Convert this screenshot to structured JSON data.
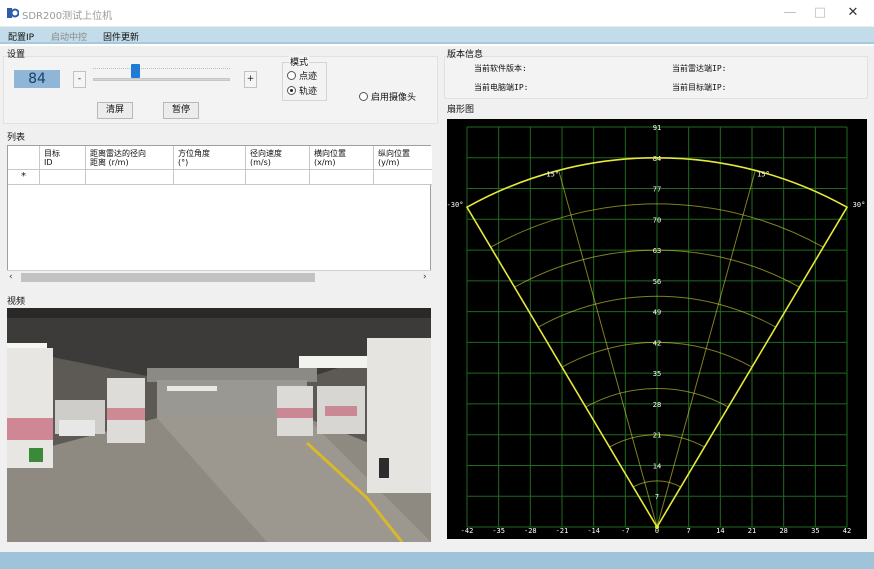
{
  "window": {
    "title": "SDR200测试上位机",
    "minimize": "—",
    "maximize": "□",
    "close": "✕"
  },
  "menu": {
    "items": [
      {
        "label": "配置IP",
        "enabled": true
      },
      {
        "label": "启动中控",
        "enabled": false
      },
      {
        "label": "固件更新",
        "enabled": true
      }
    ]
  },
  "settings": {
    "group_label": "设置",
    "value": "84",
    "minus_label": "-",
    "plus_label": "+",
    "slider_fraction": 0.31,
    "clear_button": "清屏",
    "pause_button": "暂停",
    "mode_label": "模式",
    "mode_options": [
      {
        "label": "点迹",
        "selected": false
      },
      {
        "label": "轨迹",
        "selected": true
      }
    ],
    "camera_label": "启用摄像头",
    "camera_enabled": false
  },
  "version_info": {
    "group_label": "版本信息",
    "software_version_label": "当前软件版本:",
    "radar_ip_label": "当前雷达端IP:",
    "pc_ip_label": "当前电脑端IP:",
    "target_ip_label": "当前目标端IP:"
  },
  "list": {
    "group_label": "列表",
    "columns": [
      "目标\nID",
      "距离雷达的径向\n距离 (r/m)",
      "方位角度\n(°)",
      "径向速度\n(m/s)",
      "横向位置\n(x/m)",
      "纵向位置\n(y/m)"
    ],
    "new_row_marker": "*"
  },
  "video": {
    "group_label": "视频"
  },
  "radar_chart": {
    "group_label": "扇形图",
    "colors": {
      "background": "#000000",
      "grid": "#1f6b1f",
      "sector": "#e6e83a",
      "text": "#ffffff"
    }
  },
  "chart_data": {
    "type": "scatter",
    "title": "",
    "x_ticks": [
      -42,
      -35,
      -28,
      -21,
      -14,
      -7,
      0,
      7,
      14,
      21,
      28,
      35,
      42
    ],
    "y_ticks": [
      0,
      7,
      14,
      21,
      28,
      35,
      42,
      49,
      56,
      63,
      70,
      77,
      84,
      91
    ],
    "xlim": [
      -42,
      42
    ],
    "ylim": [
      0,
      91
    ],
    "sector_max_range": 84,
    "sector_half_angle_deg": 30,
    "angle_labels": [
      "-30°",
      "-15°",
      "15°",
      "30°"
    ],
    "grid": true,
    "series": []
  }
}
